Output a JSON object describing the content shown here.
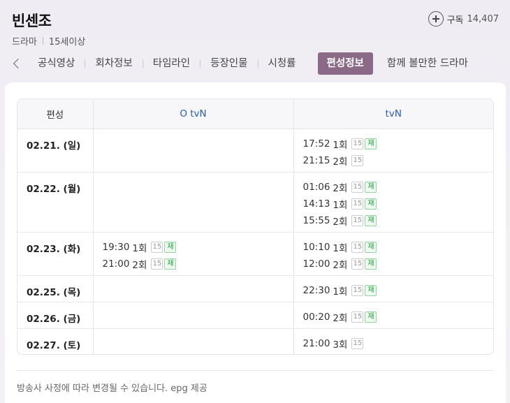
{
  "header": {
    "title": "빈센조",
    "genre": "드라마",
    "rating": "15세이상",
    "subscribe_label": "구독",
    "subscribe_count": "14,407"
  },
  "tabs": [
    {
      "label": "공식영상",
      "active": false
    },
    {
      "label": "회차정보",
      "active": false
    },
    {
      "label": "타임라인",
      "active": false
    },
    {
      "label": "등장인물",
      "active": false
    },
    {
      "label": "시청률",
      "active": false
    },
    {
      "label": "편성정보",
      "active": true
    },
    {
      "label": "함께 볼만한 드라마",
      "active": false
    }
  ],
  "schedule": {
    "columns": [
      "편성",
      "O tvN",
      "tvN"
    ],
    "rows": [
      {
        "date": "02.21. (일)",
        "otvn": [],
        "tvn": [
          {
            "time": "17:52",
            "ep": "1회",
            "age": "15",
            "re": "재"
          },
          {
            "time": "21:15",
            "ep": "2회",
            "age": "15",
            "re": ""
          }
        ]
      },
      {
        "date": "02.22. (월)",
        "otvn": [],
        "tvn": [
          {
            "time": "01:06",
            "ep": "2회",
            "age": "15",
            "re": "재"
          },
          {
            "time": "14:13",
            "ep": "1회",
            "age": "15",
            "re": "재"
          },
          {
            "time": "15:55",
            "ep": "2회",
            "age": "15",
            "re": "재"
          }
        ]
      },
      {
        "date": "02.23. (화)",
        "otvn": [
          {
            "time": "19:30",
            "ep": "1회",
            "age": "15",
            "re": "재"
          },
          {
            "time": "21:00",
            "ep": "2회",
            "age": "15",
            "re": "재"
          }
        ],
        "tvn": [
          {
            "time": "10:10",
            "ep": "1회",
            "age": "15",
            "re": "재"
          },
          {
            "time": "12:00",
            "ep": "2회",
            "age": "15",
            "re": "재"
          }
        ]
      },
      {
        "date": "02.25. (목)",
        "otvn": [],
        "tvn": [
          {
            "time": "22:30",
            "ep": "1회",
            "age": "15",
            "re": "재"
          }
        ]
      },
      {
        "date": "02.26. (금)",
        "otvn": [],
        "tvn": [
          {
            "time": "00:20",
            "ep": "2회",
            "age": "15",
            "re": "재"
          }
        ]
      },
      {
        "date": "02.27. (토)",
        "otvn": [],
        "tvn": [
          {
            "time": "21:00",
            "ep": "3회",
            "age": "15",
            "re": ""
          }
        ]
      }
    ]
  },
  "footnote": "방송사 사정에 따라 변경될 수 있습니다. epg 제공"
}
